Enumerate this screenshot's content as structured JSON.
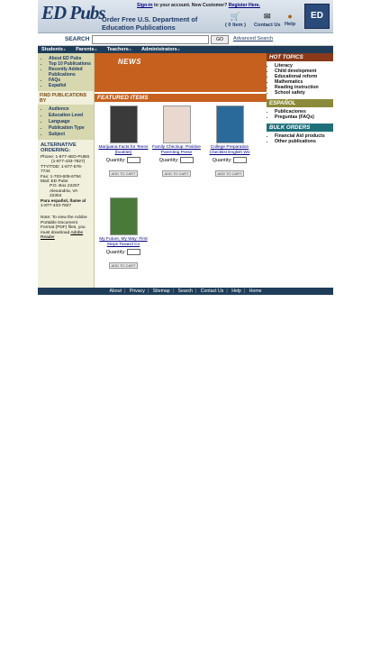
{
  "header": {
    "logo": "ED Pubs",
    "tagline": "Order Free U.S. Department of Education Publications",
    "signin_link": "Sign-in",
    "signin_text": " to your account. New Customer? ",
    "register_link": "Register Here.",
    "cart_label": "( 0 Item )",
    "contact_label": "Contact Us",
    "help_label": "Help",
    "seal": "ED"
  },
  "search": {
    "label": "SEARCH",
    "placeholder": "",
    "go_label": "GO",
    "advanced_label": "Advanced Search"
  },
  "nav": {
    "tabs": [
      "Students",
      "Parents",
      "Teachers",
      "Administrators"
    ]
  },
  "sidebar": {
    "top_links": [
      "About ED Pubs",
      "Top 10 Publications",
      "Recently Added Publications",
      "FAQs",
      "Español"
    ],
    "find_heading": "FIND PUBLICATIONS BY",
    "find_links": [
      "Audience",
      "Education Level",
      "Language",
      "Publication Type",
      "Subject"
    ],
    "alt_heading": "ALTERNATIVE ORDERING:",
    "phone": "Phone: 1-877-4ED-PUBS",
    "phone2": "(1-877-433-7827)",
    "tty": "TTY/TDD: 1-877-576-7734",
    "fax": "Fax: 1-703-605-6794",
    "mail": "Mail: ED Pubs",
    "mail2": "P.O. Box 22207",
    "mail3": "Alexandria, VA",
    "mail4": "22304",
    "espanol": "Para español, llame al",
    "espanol2": "1-877-433-7827",
    "note": "Note: To view the Adobe Portable Document Format (PDF) files, you must download ",
    "note_link": "Adobe Reader"
  },
  "main": {
    "news_title": "NEWS",
    "featured_title": "FEATURED ITEMS",
    "quantity_label": "Quantity:",
    "add_label": "ADD TO CART",
    "products": [
      {
        "title": "Marijuana Facts for Teens (booklet)",
        "cover": "#3a3a3a"
      },
      {
        "title": "Family Checkup: Positive Parenting Prese",
        "cover": "#e8d8d0"
      },
      {
        "title": "College Preparation Checklist English Wo",
        "cover": "#2a6a9a"
      },
      {
        "title": "My Future, My Way: First Steps Toward Co",
        "cover": "#4a7a3a"
      }
    ]
  },
  "right": {
    "hot_heading": "HOT TOPICS",
    "hot_links": [
      "Literacy",
      "Child development",
      "Educational reform",
      "Mathematics",
      "Reading instruction",
      "School safety"
    ],
    "espanol_heading": "ESPAÑOL",
    "espanol_links": [
      "Publicaciones",
      "Preguntas (FAQs)"
    ],
    "bulk_heading": "BULK ORDERS",
    "bulk_links": [
      "Financial Aid products",
      "Other publications"
    ]
  },
  "footer": {
    "links": [
      "About",
      "Privacy",
      "Sitemap",
      "Search",
      "Contact Us",
      "Help",
      "Home"
    ]
  }
}
